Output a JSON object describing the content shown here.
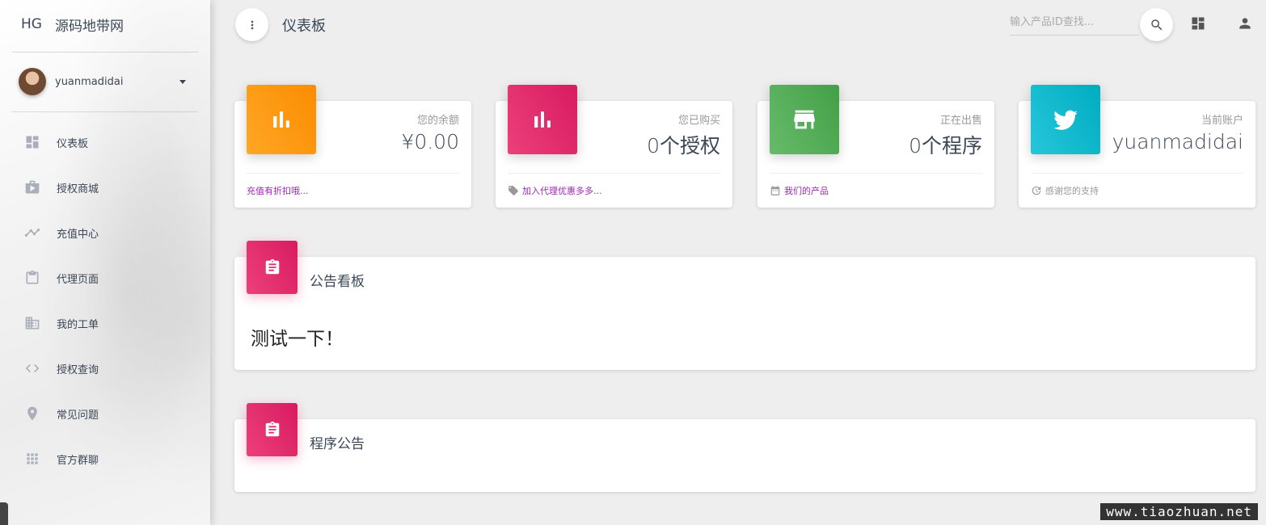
{
  "brand": {
    "mini": "HG",
    "name": "源码地带网"
  },
  "user": {
    "name": "yuanmadidai"
  },
  "nav": [
    {
      "label": "仪表板",
      "icon": "dashboard-icon"
    },
    {
      "label": "授权商城",
      "icon": "shop-icon"
    },
    {
      "label": "充值中心",
      "icon": "timeline-icon"
    },
    {
      "label": "代理页面",
      "icon": "clipboard-icon"
    },
    {
      "label": "我的工单",
      "icon": "building-icon"
    },
    {
      "label": "授权查询",
      "icon": "code-icon"
    },
    {
      "label": "常见问题",
      "icon": "location-pin-icon"
    },
    {
      "label": "官方群聊",
      "icon": "apps-grid-icon"
    }
  ],
  "topbar": {
    "title": "仪表板",
    "search_placeholder": "输入产品ID查找..."
  },
  "stats": [
    {
      "category": "您的余额",
      "value": "¥0.00",
      "footer": "充值有折扣哦...",
      "icon": "bar-chart-icon",
      "color": "#fb8c00"
    },
    {
      "category": "您已购买",
      "value": "0个授权",
      "footer": "加入代理优惠多多...",
      "footer_icon": "tag-icon",
      "icon": "bar-chart-icon",
      "color": "#d81b60"
    },
    {
      "category": "正在出售",
      "value": "0个程序",
      "footer": "我们的产品",
      "footer_icon": "calendar-icon",
      "icon": "store-icon",
      "color": "#43a047"
    },
    {
      "category": "当前账户",
      "value": "yuanmadidai",
      "footer": "感谢您的支持",
      "footer_icon": "update-icon",
      "icon": "twitter-icon",
      "color": "#00acc1"
    }
  ],
  "notices": [
    {
      "title": "公告看板",
      "body": "测试一下！"
    },
    {
      "title": "程序公告",
      "body": ""
    }
  ],
  "watermark": "www.tiaozhuan.net",
  "colors": {
    "link": "#9c27b0",
    "muted": "#999999",
    "accent_pink": "#e91e63"
  }
}
